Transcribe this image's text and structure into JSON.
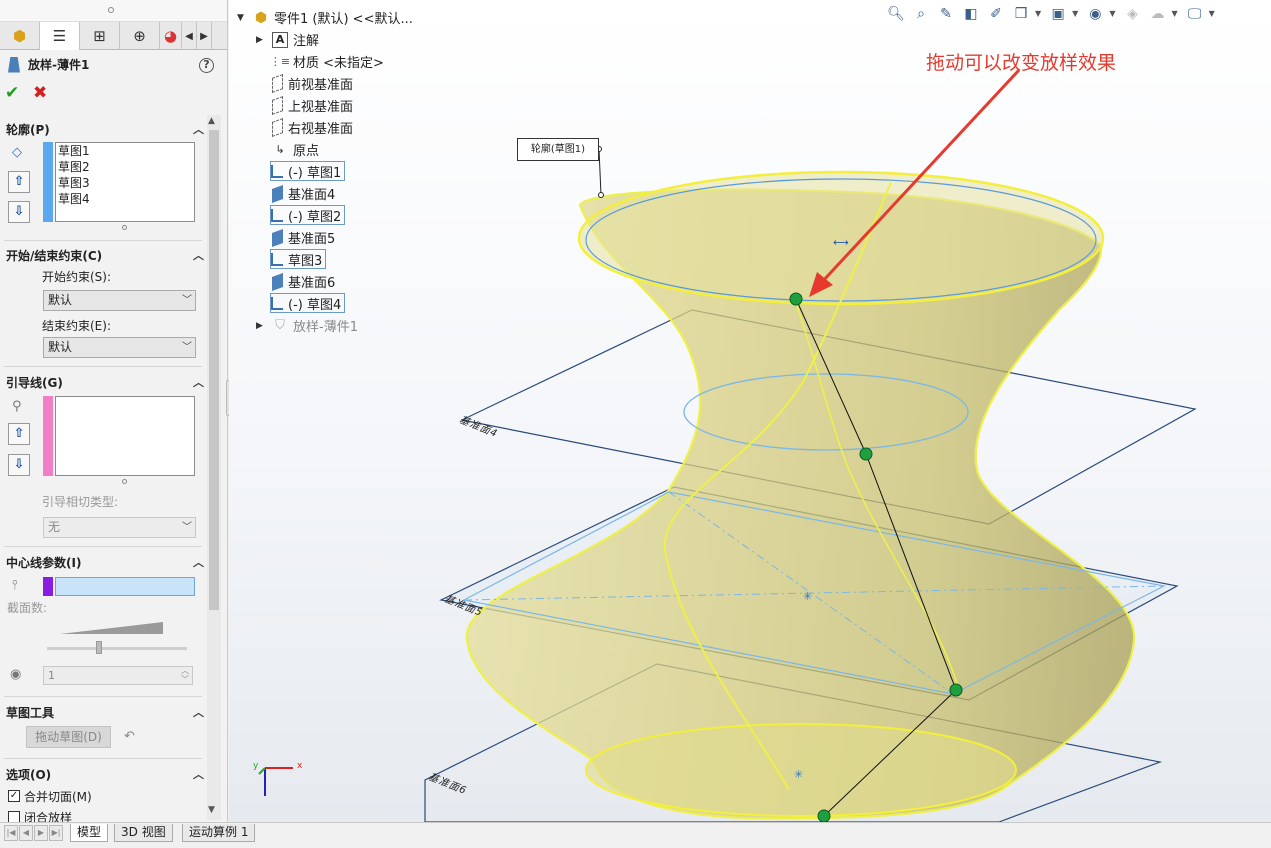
{
  "property_manager": {
    "tabs": [
      "feature-manager",
      "property-manager",
      "configuration-manager",
      "dimxpert-manager",
      "display-manager"
    ],
    "title": "放样-薄件1",
    "help": "?",
    "ok": "✔",
    "cancel": "✖",
    "profiles": {
      "heading": "轮廓(P)",
      "items": [
        "草图1",
        "草图2",
        "草图3",
        "草图4"
      ],
      "color": "#5ba8f0"
    },
    "constraints": {
      "heading": "开始/结束约束(C)",
      "start_label": "开始约束(S):",
      "start_value": "默认",
      "end_label": "结束约束(E):",
      "end_value": "默认"
    },
    "guides": {
      "heading": "引导线(G)",
      "color": "#f37ec8",
      "tangency_label": "引导相切类型:",
      "tangency_value": "无"
    },
    "centerline": {
      "heading": "中心线参数(I)",
      "color": "#8a1ee0",
      "sections_label": "截面数:",
      "sections_value": "1"
    },
    "sketch_tools": {
      "heading": "草图工具",
      "drag_button": "拖动草图(D)"
    },
    "options": {
      "heading": "选项(O)",
      "merge_tangent": "合并切面(M)",
      "close_loft": "闭合放样"
    }
  },
  "feature_tree": {
    "root": "零件1 (默认) <<默认...",
    "items": [
      {
        "label": "注解",
        "icon": "annotation-icon"
      },
      {
        "label": "材质 <未指定>",
        "icon": "material-icon"
      },
      {
        "label": "前视基准面",
        "icon": "plane-icon"
      },
      {
        "label": "上视基准面",
        "icon": "plane-icon"
      },
      {
        "label": "右视基准面",
        "icon": "plane-icon"
      },
      {
        "label": "原点",
        "icon": "origin-icon"
      },
      {
        "label": "(-) 草图1",
        "icon": "sketch-icon"
      },
      {
        "label": "基准面4",
        "icon": "ref-plane-icon"
      },
      {
        "label": "(-) 草图2",
        "icon": "sketch-icon"
      },
      {
        "label": "基准面5",
        "icon": "ref-plane-icon"
      },
      {
        "label": "草图3",
        "icon": "sketch-icon"
      },
      {
        "label": "基准面6",
        "icon": "ref-plane-icon"
      },
      {
        "label": "(-) 草图4",
        "icon": "sketch-icon"
      },
      {
        "label": "放样-薄件1",
        "icon": "loft-icon"
      }
    ]
  },
  "viewport": {
    "annotation": "拖动可以改变放样效果",
    "annotation_color": "#e63a2e",
    "callout": "轮廓(草图1)",
    "plane_labels": [
      "基准面4",
      "基准面5",
      "基准面6"
    ],
    "triad": {
      "x": "x",
      "y": "y"
    },
    "toolbar_icons": [
      "zoom-to-fit-icon",
      "zoom-area-icon",
      "previous-view-icon",
      "section-view-icon",
      "dynamic-annotation-icon",
      "view-orientation-icon",
      "display-style-icon",
      "hide-show-icon",
      "edit-appearance-icon",
      "apply-scene-icon",
      "view-settings-icon"
    ]
  },
  "bottom_tabs": [
    "模型",
    "3D 视图",
    "运动算例 1"
  ]
}
